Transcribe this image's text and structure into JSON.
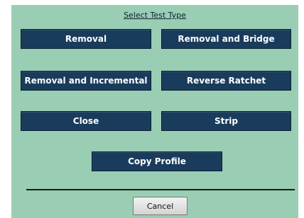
{
  "dialog": {
    "title": "Select Test Type",
    "background_color": "#99cdb4",
    "button_color": "#1a3c5c"
  },
  "buttons": {
    "removal": "Removal",
    "removal_and_bridge": "Removal and Bridge",
    "removal_and_incremental": "Removal and Incremental",
    "reverse_ratchet": "Reverse Ratchet",
    "close": "Close",
    "strip": "Strip",
    "copy_profile": "Copy Profile",
    "cancel": "Cancel"
  }
}
